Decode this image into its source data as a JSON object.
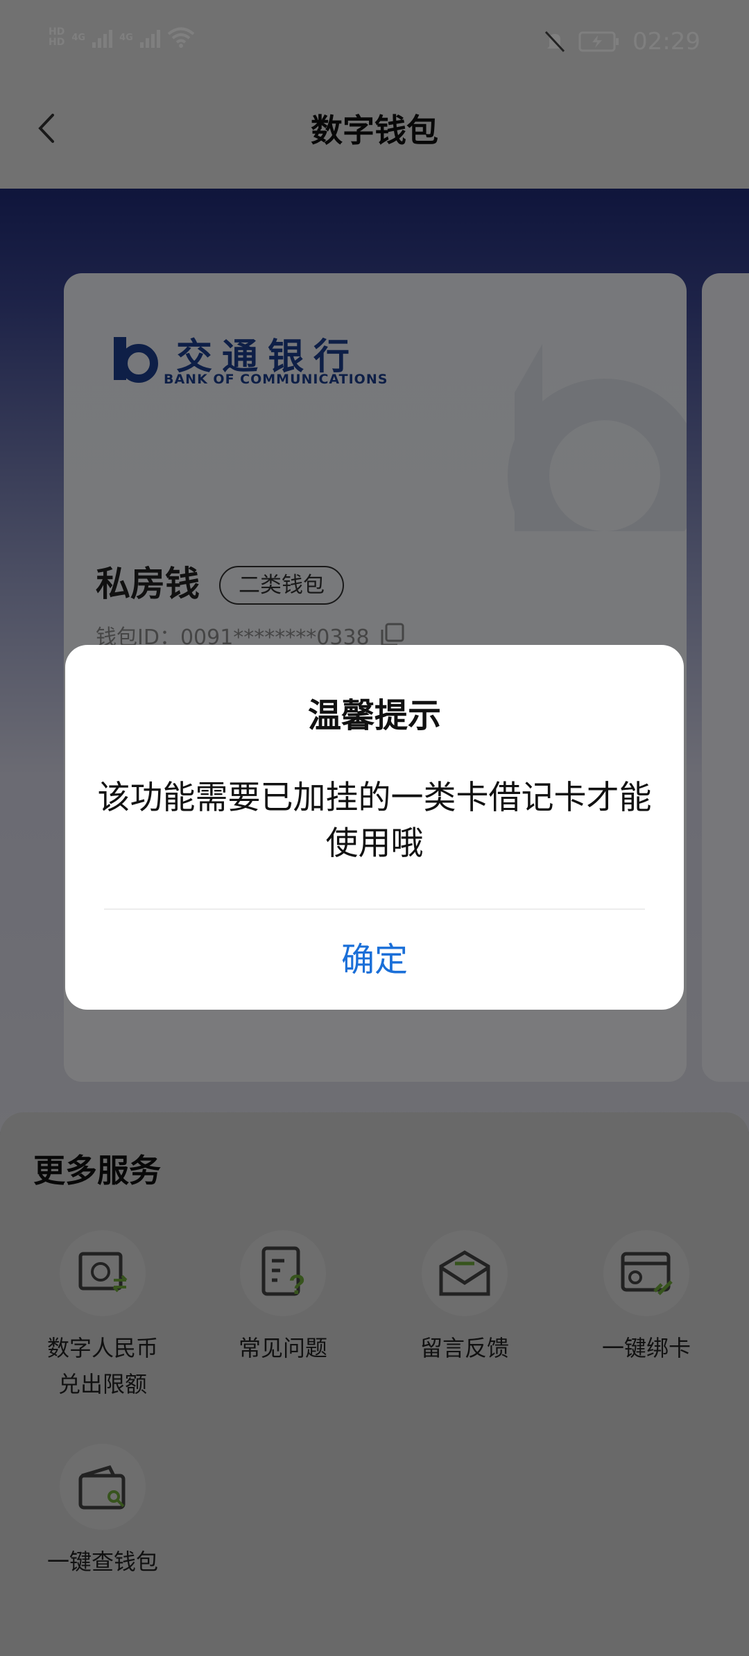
{
  "status_bar": {
    "time": "02:29",
    "network_1": "4G",
    "network_2": "4G",
    "hd_1": "HD",
    "hd_2": "HD",
    "icons": [
      "signal-icon",
      "wifi-icon",
      "mute-icon",
      "battery-charging-icon"
    ]
  },
  "nav": {
    "title": "数字钱包",
    "back_icon": "chevron-left-icon"
  },
  "card": {
    "bank_name_cn": "交通银行",
    "bank_name_en": "BANK OF COMMUNICATIONS",
    "wallet_name": "私房钱",
    "wallet_tag": "二类钱包",
    "wallet_id": "钱包ID：0091********0338"
  },
  "services": {
    "title": "更多服务",
    "items": [
      {
        "label": "数字人民币兑出限额",
        "icon": "exchange-limit-icon"
      },
      {
        "label": "常见问题",
        "icon": "faq-icon"
      },
      {
        "label": "留言反馈",
        "icon": "feedback-icon"
      },
      {
        "label": "一键绑卡",
        "icon": "bind-card-icon"
      },
      {
        "label": "一键查钱包",
        "icon": "find-wallet-icon"
      }
    ]
  },
  "dialog": {
    "title": "温馨提示",
    "message": "该功能需要已加挂的一类卡借记卡才能使用哦",
    "confirm": "确定"
  },
  "colors": {
    "accent": "#1a6fd8",
    "bank_blue": "#1c3f8f",
    "header_dark": "#1f2b78",
    "green": "#6fa83a"
  }
}
